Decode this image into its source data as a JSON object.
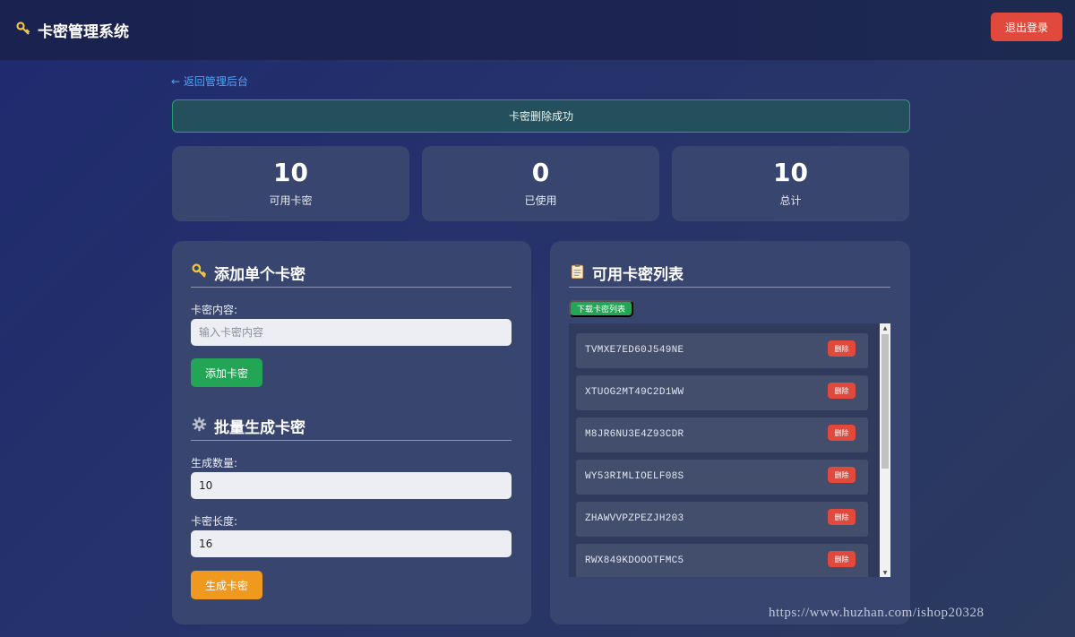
{
  "header": {
    "icon": "key-icon",
    "title": "卡密管理系统",
    "logout_label": "退出登录"
  },
  "back_link": "← 返回管理后台",
  "alert": "卡密删除成功",
  "stats": [
    {
      "value": "10",
      "label": "可用卡密"
    },
    {
      "value": "0",
      "label": "已使用"
    },
    {
      "value": "10",
      "label": "总计"
    }
  ],
  "add_single": {
    "icon": "key-icon",
    "title": "添加单个卡密",
    "content_label": "卡密内容:",
    "content_placeholder": "输入卡密内容",
    "add_button": "添加卡密"
  },
  "batch": {
    "icon": "gear-icon",
    "title": "批量生成卡密",
    "count_label": "生成数量:",
    "count_value": "10",
    "length_label": "卡密长度:",
    "length_value": "16",
    "generate_button": "生成卡密"
  },
  "card_list": {
    "icon": "clipboard-icon",
    "title": "可用卡密列表",
    "download_button": "下载卡密列表",
    "delete_label": "删除",
    "items": [
      {
        "code": "TVMXE7ED60J549NE"
      },
      {
        "code": "XTUOG2MT49C2D1WW"
      },
      {
        "code": "M8JR6NU3E4Z93CDR"
      },
      {
        "code": "WY53RIMLIOELF08S"
      },
      {
        "code": "ZHAWVVPZPEZJH203"
      },
      {
        "code": "RWX849KDOOOTFMC5"
      }
    ]
  },
  "watermark": "https://www.huzhan.com/ishop20328",
  "colors": {
    "accent_green": "#22a555",
    "danger_red": "#e0493b",
    "warning_orange": "#ef9a1f",
    "link_blue": "#4ea6f5",
    "panel_bg": "#38456f"
  }
}
